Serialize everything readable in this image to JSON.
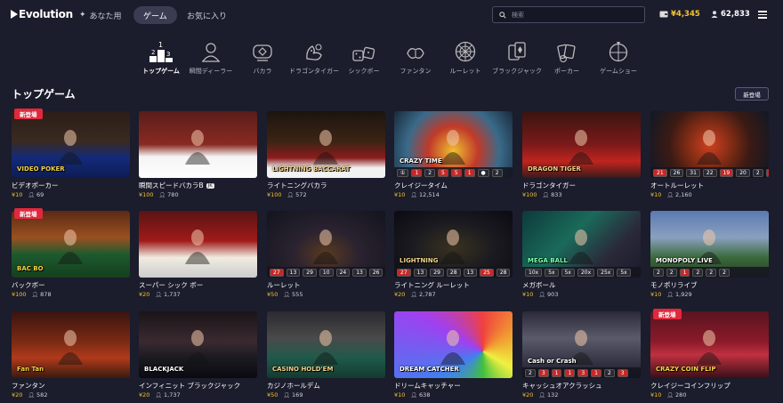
{
  "header": {
    "brand": "Evolution",
    "tabs": [
      {
        "label": "あなた用",
        "active": false
      },
      {
        "label": "ゲーム",
        "active": true
      },
      {
        "label": "お気に入り",
        "active": false
      }
    ],
    "search_placeholder": "検索",
    "balance": "¥4,345",
    "players": "62,833"
  },
  "categories": [
    {
      "label": "トップゲーム",
      "icon": "podium-icon",
      "active": true
    },
    {
      "label": "瞬間ディーラー",
      "icon": "dealer-icon",
      "active": false
    },
    {
      "label": "バカラ",
      "icon": "baccarat-icon",
      "active": false
    },
    {
      "label": "ドラゴンタイガー",
      "icon": "dragon-tiger-icon",
      "active": false
    },
    {
      "label": "シックボー",
      "icon": "dice-icon",
      "active": false
    },
    {
      "label": "ファンタン",
      "icon": "fantan-icon",
      "active": false
    },
    {
      "label": "ルーレット",
      "icon": "roulette-icon",
      "active": false
    },
    {
      "label": "ブラックジャック",
      "icon": "cards-icon",
      "active": false
    },
    {
      "label": "ポーカー",
      "icon": "poker-icon",
      "active": false
    },
    {
      "label": "ゲームショー",
      "icon": "gameshow-icon",
      "active": false
    }
  ],
  "section": {
    "title": "トップゲーム",
    "new_button": "新登場"
  },
  "new_badge": "新登場",
  "games": [
    {
      "name": "ビデオポーカー",
      "bet": "¥10",
      "players": "69",
      "new": true,
      "theme": "poker",
      "overlay": "VIDEO POKER"
    },
    {
      "name": "瞬間スピードバカラB",
      "bet": "¥100",
      "players": "780",
      "new": false,
      "theme": "speedbac",
      "tag": "JK",
      "overlay": ""
    },
    {
      "name": "ライトニングバカラ",
      "bet": "¥100",
      "players": "572",
      "new": false,
      "theme": "lbac",
      "overlay": "LIGHTNING BACCARAT"
    },
    {
      "name": "クレイジータイム",
      "bet": "¥10",
      "players": "12,514",
      "new": false,
      "theme": "crazy",
      "overlay": "CRAZY TIME",
      "strip": [
        "①",
        "1",
        "2",
        "5",
        "5",
        "1",
        "●",
        "2"
      ]
    },
    {
      "name": "ドラゴンタイガー",
      "bet": "¥100",
      "players": "833",
      "new": false,
      "theme": "dragon",
      "overlay": "DRAGON TIGER"
    },
    {
      "name": "オートルーレット",
      "bet": "¥10",
      "players": "2,160",
      "new": false,
      "theme": "auto",
      "overlay": "",
      "strip": [
        "21",
        "26",
        "31",
        "22",
        "19",
        "20",
        "2",
        "36"
      ]
    },
    {
      "name": "バックボー",
      "bet": "¥100",
      "players": "878",
      "new": true,
      "theme": "bacbo",
      "overlay": "BAC BO"
    },
    {
      "name": "スーパー シック ボー",
      "bet": "¥20",
      "players": "1,737",
      "new": false,
      "theme": "sicbo",
      "overlay": ""
    },
    {
      "name": "ルーレット",
      "bet": "¥50",
      "players": "555",
      "new": false,
      "theme": "roulette",
      "overlay": "",
      "strip": [
        "27",
        "13",
        "29",
        "10",
        "24",
        "13",
        "26",
        "2"
      ]
    },
    {
      "name": "ライトニング ルーレット",
      "bet": "¥20",
      "players": "2,787",
      "new": false,
      "theme": "lroul",
      "overlay": "LIGHTNING",
      "strip": [
        "27",
        "13",
        "29",
        "28",
        "13",
        "25",
        "28",
        "3"
      ]
    },
    {
      "name": "メガボール",
      "bet": "¥10",
      "players": "903",
      "new": false,
      "theme": "mega",
      "overlay": "MEGA BALL",
      "strip": [
        "10x",
        "5x",
        "5x",
        "20x",
        "25x",
        "5x"
      ]
    },
    {
      "name": "モノポリライブ",
      "bet": "¥10",
      "players": "1,929",
      "new": false,
      "theme": "mono",
      "overlay": "MONOPOLY LIVE",
      "strip": [
        "2",
        "2",
        "1",
        "2",
        "2",
        "2"
      ]
    },
    {
      "name": "ファンタン",
      "bet": "¥20",
      "players": "582",
      "new": false,
      "theme": "fantan",
      "overlay": "Fan Tan"
    },
    {
      "name": "インフィニット ブラックジャック",
      "bet": "¥20",
      "players": "1,737",
      "new": false,
      "theme": "bj",
      "overlay": "BLACKJACK"
    },
    {
      "name": "カジノホールデム",
      "bet": "¥50",
      "players": "169",
      "new": false,
      "theme": "holdem",
      "overlay": "CASINO HOLD'EM"
    },
    {
      "name": "ドリームキャッチャー",
      "bet": "¥10",
      "players": "638",
      "new": false,
      "theme": "dream",
      "overlay": "DREAM CATCHER"
    },
    {
      "name": "キャッシュオアクラッシュ",
      "bet": "¥20",
      "players": "132",
      "new": false,
      "theme": "cash",
      "overlay": "Cash or Crash",
      "strip": [
        "2",
        "3",
        "1",
        "1",
        "3",
        "1",
        "2",
        "3"
      ]
    },
    {
      "name": "クレイジーコインフリップ",
      "bet": "¥10",
      "players": "280",
      "new": true,
      "theme": "coin",
      "overlay": "CRAZY COIN FLIP"
    }
  ]
}
